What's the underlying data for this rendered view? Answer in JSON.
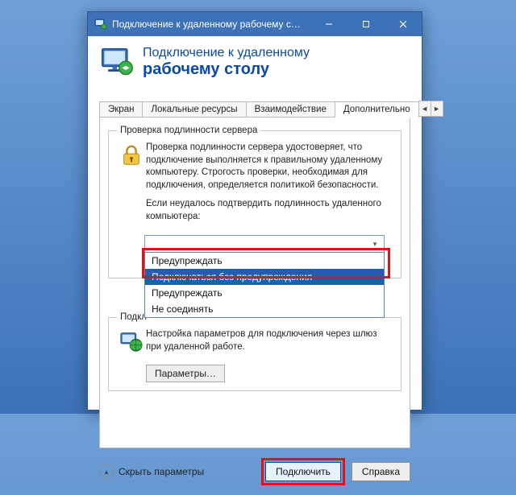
{
  "window": {
    "title": "Подключение к удаленному рабочему с…"
  },
  "banner": {
    "line1": "Подключение к удаленному",
    "line2": "рабочему столу"
  },
  "tabs": {
    "items": [
      {
        "label": "Экран"
      },
      {
        "label": "Локальные ресурсы"
      },
      {
        "label": "Взаимодействие"
      },
      {
        "label": "Дополнительно"
      }
    ],
    "active_index": 3
  },
  "group_auth": {
    "legend": "Проверка подлинности сервера",
    "desc": "Проверка подлинности сервера удостоверяет, что подключение выполняется к правильному удаленному компьютеру. Строгость проверки, необходимая для подключения, определяется политикой безопасности.",
    "prompt": "Если неудалось подтвердить подлинность удаленного компьютера:",
    "select": {
      "options": [
        {
          "label": "Предупреждать"
        },
        {
          "label": "Подключаться без предупреждения"
        },
        {
          "label": "Предупреждать"
        },
        {
          "label": "Не соединять"
        }
      ],
      "highlighted_index": 1
    }
  },
  "group_gw": {
    "legend": "Подкл",
    "desc": "Настройка параметров для подключения через шлюз при удаленной работе.",
    "button": "Параметры…"
  },
  "footer": {
    "toggle": "Скрыть параметры",
    "connect": "Подключить",
    "help": "Справка"
  }
}
